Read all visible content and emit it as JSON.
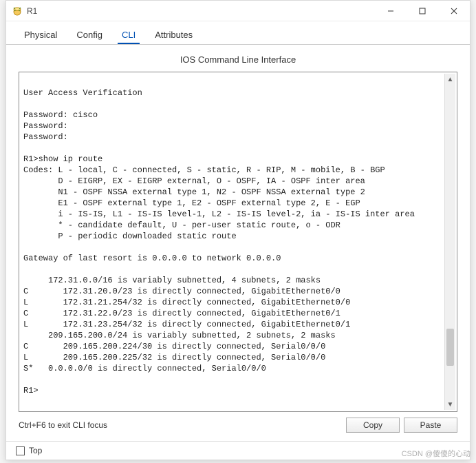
{
  "window": {
    "title": "R1"
  },
  "tabs": [
    {
      "label": "Physical",
      "active": false
    },
    {
      "label": "Config",
      "active": false
    },
    {
      "label": "CLI",
      "active": true
    },
    {
      "label": "Attributes",
      "active": false
    }
  ],
  "cli": {
    "title": "IOS Command Line Interface",
    "text": "\nUser Access Verification\n\nPassword: cisco\nPassword: \nPassword: \n\nR1>show ip route\nCodes: L - local, C - connected, S - static, R - RIP, M - mobile, B - BGP\n       D - EIGRP, EX - EIGRP external, O - OSPF, IA - OSPF inter area\n       N1 - OSPF NSSA external type 1, N2 - OSPF NSSA external type 2\n       E1 - OSPF external type 1, E2 - OSPF external type 2, E - EGP\n       i - IS-IS, L1 - IS-IS level-1, L2 - IS-IS level-2, ia - IS-IS inter area\n       * - candidate default, U - per-user static route, o - ODR\n       P - periodic downloaded static route\n\nGateway of last resort is 0.0.0.0 to network 0.0.0.0\n\n     172.31.0.0/16 is variably subnetted, 4 subnets, 2 masks\nC       172.31.20.0/23 is directly connected, GigabitEthernet0/0\nL       172.31.21.254/32 is directly connected, GigabitEthernet0/0\nC       172.31.22.0/23 is directly connected, GigabitEthernet0/1\nL       172.31.23.254/32 is directly connected, GigabitEthernet0/1\n     209.165.200.0/24 is variably subnetted, 2 subnets, 2 masks\nC       209.165.200.224/30 is directly connected, Serial0/0/0\nL       209.165.200.225/32 is directly connected, Serial0/0/0\nS*   0.0.0.0/0 is directly connected, Serial0/0/0\n\nR1>",
    "hint": "Ctrl+F6 to exit CLI focus",
    "copy_label": "Copy",
    "paste_label": "Paste"
  },
  "footer": {
    "top_label": "Top",
    "top_checked": false
  },
  "watermark": "CSDN @傻傻的心动"
}
